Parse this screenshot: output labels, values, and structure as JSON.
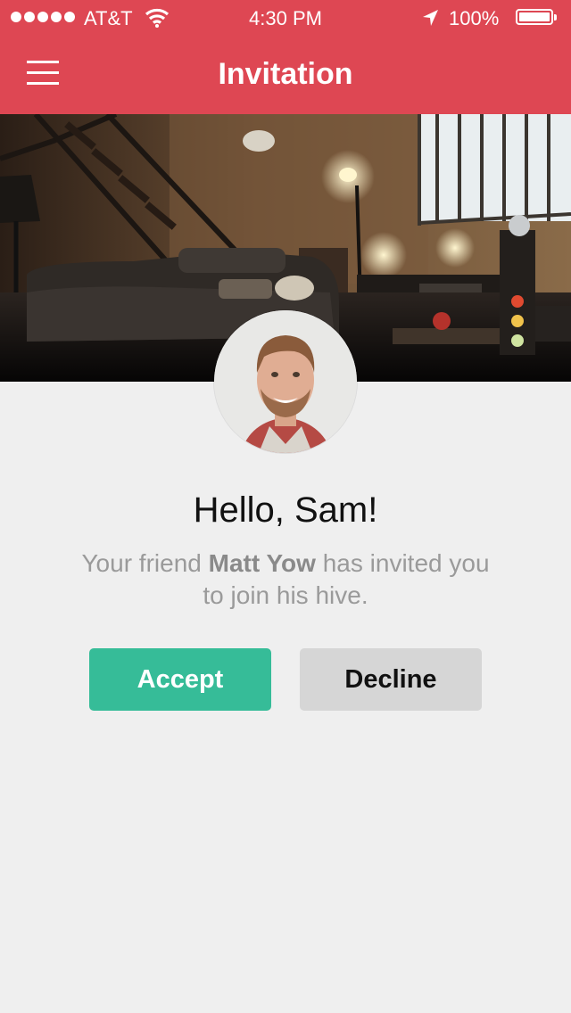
{
  "status_bar": {
    "carrier": "AT&T",
    "time": "4:30 PM",
    "battery": "100%"
  },
  "nav": {
    "title": "Invitation",
    "menu_icon": "hamburger-menu-icon"
  },
  "invite": {
    "greeting": "Hello, Sam!",
    "message_prefix": "Your friend ",
    "friend_name": "Matt Yow",
    "message_suffix": " has invited you to join his hive.",
    "accept_label": "Accept",
    "decline_label": "Decline"
  },
  "colors": {
    "header": "#de4753",
    "accept": "#36bc98",
    "decline": "#d6d6d6",
    "background": "#efefef"
  }
}
